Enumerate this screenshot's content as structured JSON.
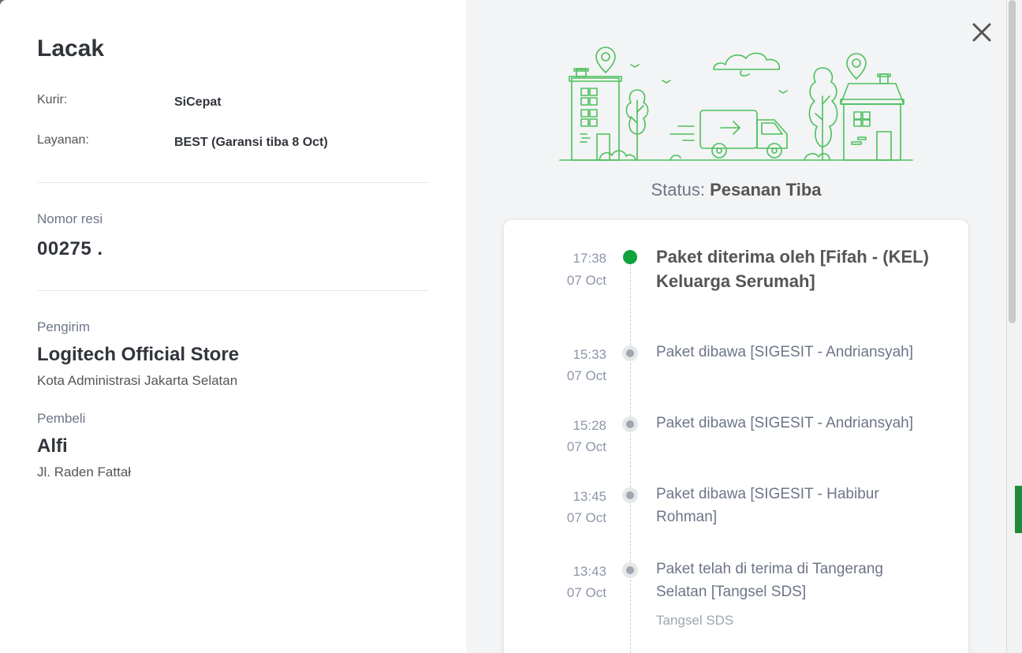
{
  "tracking": {
    "title": "Lacak",
    "courier_label": "Kurir:",
    "courier_value": "SiCepat",
    "service_label": "Layanan:",
    "service_value": "BEST (Garansi tiba 8 Oct)",
    "receipt_label": "Nomor resi",
    "receipt_value": "00275 .",
    "sender_label": "Pengirim",
    "sender_name": "Logitech Official Store",
    "sender_address": "Kota Administrasi Jakarta Selatan",
    "buyer_label": "Pembeli",
    "buyer_name": "Alfi",
    "buyer_address": "Jl. Raden Fattał"
  },
  "status": {
    "prefix": "Status:",
    "value": "Pesanan Tiba"
  },
  "events": [
    {
      "time": "17:38",
      "date": "07 Oct",
      "text": "Paket diterima oleh [Fifah - (KEL) Keluarga Serumah]",
      "location": "",
      "active": true
    },
    {
      "time": "15:33",
      "date": "07 Oct",
      "text": "Paket dibawa [SIGESIT - Andriansyah]",
      "location": "",
      "active": false
    },
    {
      "time": "15:28",
      "date": "07 Oct",
      "text": "Paket dibawa [SIGESIT - Andriansyah]",
      "location": "",
      "active": false
    },
    {
      "time": "13:45",
      "date": "07 Oct",
      "text": "Paket dibawa [SIGESIT - Habibur Rohman]",
      "location": "",
      "active": false
    },
    {
      "time": "13:43",
      "date": "07 Oct",
      "text": "Paket telah di terima di Tangerang Selatan [Tangsel SDS]",
      "location": "Tangsel SDS",
      "active": false
    }
  ],
  "icons": {
    "close": "close-icon",
    "illustration": "delivery-truck-town-illustration"
  },
  "colors": {
    "accent": "#10a33d",
    "illustration": "#4cc05c"
  }
}
